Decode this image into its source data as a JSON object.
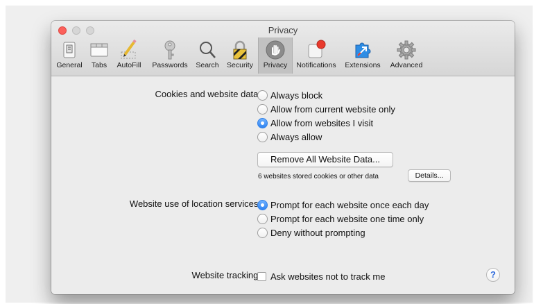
{
  "window": {
    "title": "Privacy"
  },
  "toolbar": {
    "tabs": [
      {
        "label": "General",
        "icon": "general-icon"
      },
      {
        "label": "Tabs",
        "icon": "tabs-icon"
      },
      {
        "label": "AutoFill",
        "icon": "pencil-icon"
      },
      {
        "label": "Passwords",
        "icon": "key-icon"
      },
      {
        "label": "Search",
        "icon": "magnifier-icon"
      },
      {
        "label": "Security",
        "icon": "lock-icon"
      },
      {
        "label": "Privacy",
        "icon": "hand-icon",
        "selected": true
      },
      {
        "label": "Notifications",
        "icon": "notification-icon"
      },
      {
        "label": "Extensions",
        "icon": "puzzle-icon"
      },
      {
        "label": "Advanced",
        "icon": "gear-icon"
      }
    ]
  },
  "cookies": {
    "label": "Cookies and website data:",
    "options": [
      {
        "label": "Always block",
        "selected": false
      },
      {
        "label": "Allow from current website only",
        "selected": false
      },
      {
        "label": "Allow from websites I visit",
        "selected": true
      },
      {
        "label": "Always allow",
        "selected": false
      }
    ],
    "remove_button": "Remove All Website Data...",
    "stored_note": "6 websites stored cookies or other data",
    "details_button": "Details..."
  },
  "location": {
    "label": "Website use of location services:",
    "options": [
      {
        "label": "Prompt for each website once each day",
        "selected": true
      },
      {
        "label": "Prompt for each website one time only",
        "selected": false
      },
      {
        "label": "Deny without prompting",
        "selected": false
      }
    ]
  },
  "tracking": {
    "label": "Website tracking:",
    "checkbox_label": "Ask websites not to track me",
    "checked": false
  },
  "help": {
    "symbol": "?"
  },
  "colors": {
    "accent": "#2f83f1",
    "close": "#fc605b",
    "selected_tab": "#c2c2c2"
  }
}
